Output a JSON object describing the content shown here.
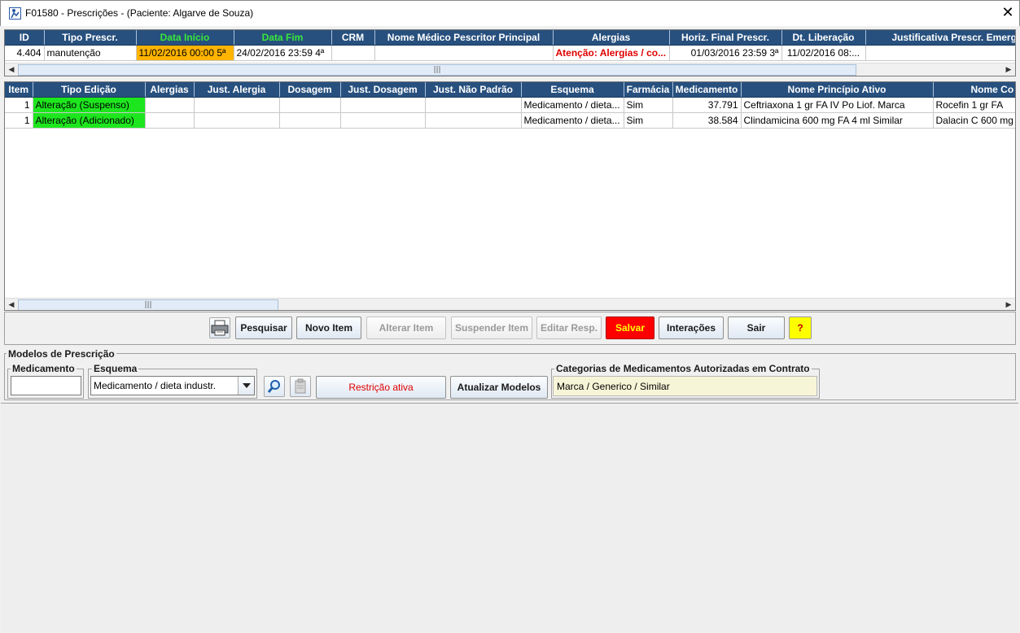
{
  "window": {
    "title": "F01580 - Prescrições - (Paciente: Algarve de Souza)",
    "close_symbol": "✕"
  },
  "prescriptions_table": {
    "columns": [
      "ID",
      "Tipo Prescr.",
      "Data Início",
      "Data Fim",
      "CRM",
      "Nome Médico Pescritor Principal",
      "Alergias",
      "Horiz. Final Prescr.",
      "Dt. Liberação",
      "Justificativa Prescr. Emerg"
    ],
    "rows": [
      [
        "4.404",
        "manutenção",
        "11/02/2016 00:00 5ª",
        "24/02/2016 23:59 4ª",
        "",
        "",
        "Atenção: Alergias / co...",
        "01/03/2016 23:59 3ª",
        "11/02/2016 08:...",
        ""
      ]
    ]
  },
  "items_table": {
    "columns": [
      "Item",
      "Tipo Edição",
      "Alergias",
      "Just. Alergia",
      "Dosagem",
      "Just. Dosagem",
      "Just. Não Padrão",
      "Esquema",
      "Farmácia",
      "Medicamento",
      "Nome Princípio Ativo",
      "Nome Co"
    ],
    "rows": [
      [
        "1",
        "Alteração (Suspenso)",
        "",
        "",
        "",
        "",
        "",
        "Medicamento / dieta...",
        "Sim",
        "37.791",
        "Ceftriaxona    1 gr  FA  IV Po Liof.   Marca",
        "Rocefin   1 gr  FA"
      ],
      [
        "1",
        "Alteração (Adicionado)",
        "",
        "",
        "",
        "",
        "",
        "Medicamento / dieta...",
        "Sim",
        "38.584",
        "Clindamicina    600 mg  FA  4 ml   Similar",
        "Dalacin C  600 mg"
      ]
    ]
  },
  "scrollbar": {
    "left_arrow": "◀",
    "right_arrow": "▶",
    "grip": "|||"
  },
  "toolbar": {
    "pesquisar": "Pesquisar",
    "novo_item": "Novo Item",
    "alterar_item": "Alterar Item",
    "suspender_item": "Suspender Item",
    "editar_resp": "Editar Resp.",
    "salvar": "Salvar",
    "interacoes": "Interações",
    "sair": "Sair",
    "help": "?"
  },
  "models": {
    "title": "Modelos de Prescrição",
    "medicamento_label": "Medicamento",
    "medicamento_value": "",
    "esquema_label": "Esquema",
    "esquema_value": "Medicamento / dieta industr.",
    "restricao_button": "Restrição ativa",
    "atualizar_button": "Atualizar Modelos",
    "categorias_label": "Categorias de Medicamentos Autorizadas em Contrato",
    "categorias_value": "Marca / Generico / Similar"
  },
  "colors": {
    "header_bg": "#27507e",
    "orange_highlight": "#ffb400",
    "green_highlight": "#1ee61e",
    "alert_red": "#e00000",
    "save_button": "#ff0000"
  }
}
